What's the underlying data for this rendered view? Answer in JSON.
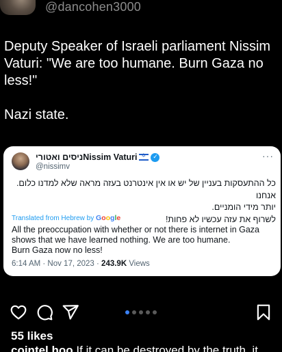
{
  "header": {
    "handle": "@dancohen3000"
  },
  "post": {
    "lines": [
      "Deputy Speaker of Israeli parliament Nissim",
      "Vaturi: \"We are too humane. Burn Gaza no",
      "less!\""
    ],
    "closing": "Nazi state."
  },
  "quote_card": {
    "display_name": "ניסים ואטוריNissim Vaturi",
    "handle": "@nissimv",
    "hebrew_lines": [
      "כל ההתעסקות בעניין של יש או אין אינטרנט בעזה מראה שלא למדנו כלום. אנחנו",
      "יותר מידי הומניים.",
      "לשרוף את עזה עכשיו לא פחות!"
    ],
    "translated_label": "Translated from Hebrew by",
    "google": [
      "G",
      "o",
      "o",
      "g",
      "l",
      "e"
    ],
    "english_lines": [
      "All the preoccupation with whether or not there is internet in Gaza",
      "shows that we have learned nothing. We are too humane.",
      "Burn Gaza now no less!"
    ],
    "time_date": "6:14 AM · Nov 17, 2023 · ",
    "views_count": "243.9K",
    "views_label": " Views",
    "more_icon": "more-horizontal-icon"
  },
  "actions": {
    "icons": [
      "heart-icon",
      "comment-icon",
      "share-icon",
      "bookmark-icon"
    ],
    "carousel_dots": 5,
    "active_dot": 0
  },
  "likes": "55 likes",
  "caption": {
    "user": "cointel.hoo",
    "text": " If it can be destroyed by the truth, it"
  },
  "colors": {
    "background": "#000000",
    "card_bg": "#ffffff",
    "link_blue": "#1d9bf0",
    "muted": "#536471",
    "handle_gray": "#8c8c8c"
  }
}
